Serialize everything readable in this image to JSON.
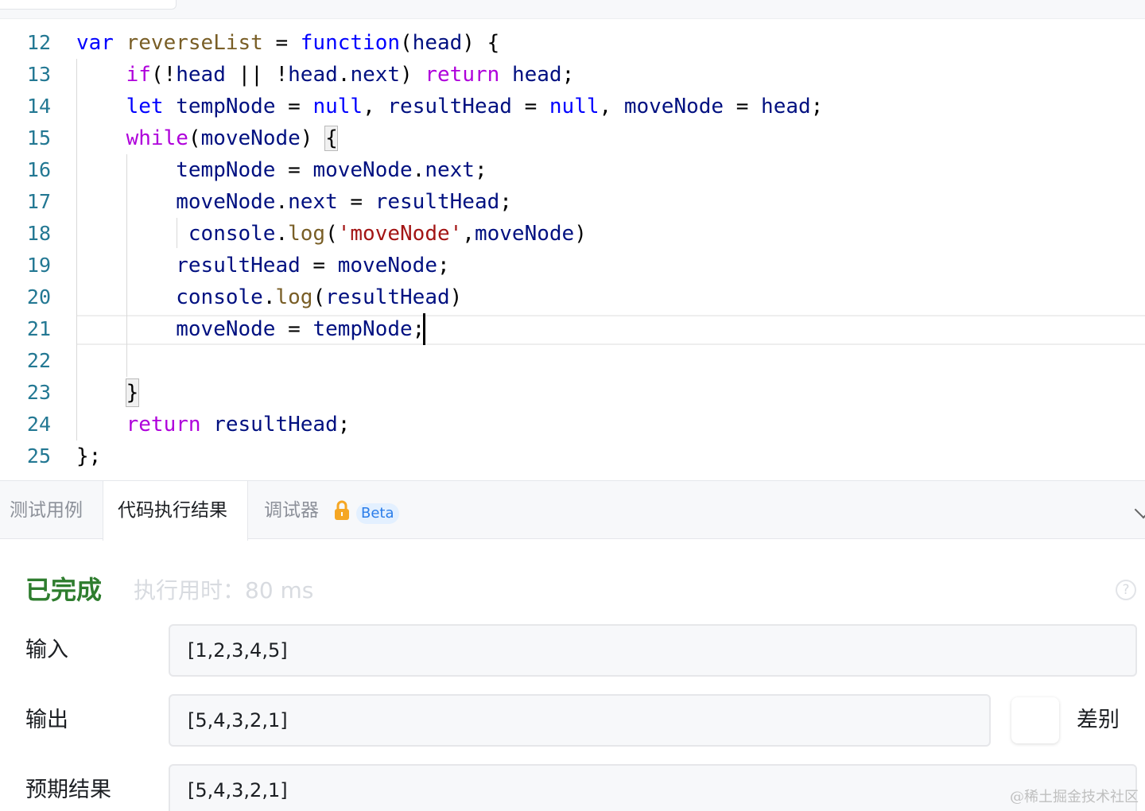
{
  "editor": {
    "lines": [
      {
        "num": "12",
        "tokens": [
          [
            "kw",
            "var"
          ],
          [
            "p",
            " "
          ],
          [
            "fn",
            "reverseList"
          ],
          [
            "p",
            " = "
          ],
          [
            "kw",
            "function"
          ],
          [
            "p",
            "("
          ],
          [
            "var",
            "head"
          ],
          [
            "p",
            ") {"
          ]
        ]
      },
      {
        "num": "13",
        "tokens": [
          [
            "p",
            "    "
          ],
          [
            "ctl",
            "if"
          ],
          [
            "p",
            "(!"
          ],
          [
            "var",
            "head"
          ],
          [
            "p",
            " || !"
          ],
          [
            "var",
            "head"
          ],
          [
            "p",
            "."
          ],
          [
            "var",
            "next"
          ],
          [
            "p",
            ") "
          ],
          [
            "ctl",
            "return"
          ],
          [
            "p",
            " "
          ],
          [
            "var",
            "head"
          ],
          [
            "p",
            ";"
          ]
        ]
      },
      {
        "num": "14",
        "tokens": [
          [
            "p",
            "    "
          ],
          [
            "kw",
            "let"
          ],
          [
            "p",
            " "
          ],
          [
            "var",
            "tempNode"
          ],
          [
            "p",
            " = "
          ],
          [
            "kw",
            "null"
          ],
          [
            "p",
            ", "
          ],
          [
            "var",
            "resultHead"
          ],
          [
            "p",
            " = "
          ],
          [
            "kw",
            "null"
          ],
          [
            "p",
            ", "
          ],
          [
            "var",
            "moveNode"
          ],
          [
            "p",
            " = "
          ],
          [
            "var",
            "head"
          ],
          [
            "p",
            ";"
          ]
        ]
      },
      {
        "num": "15",
        "tokens": [
          [
            "p",
            "    "
          ],
          [
            "ctl",
            "while"
          ],
          [
            "p",
            "("
          ],
          [
            "var",
            "moveNode"
          ],
          [
            "p",
            ") {"
          ]
        ]
      },
      {
        "num": "16",
        "tokens": [
          [
            "p",
            "        "
          ],
          [
            "var",
            "tempNode"
          ],
          [
            "p",
            " = "
          ],
          [
            "var",
            "moveNode"
          ],
          [
            "p",
            "."
          ],
          [
            "var",
            "next"
          ],
          [
            "p",
            ";"
          ]
        ]
      },
      {
        "num": "17",
        "tokens": [
          [
            "p",
            "        "
          ],
          [
            "var",
            "moveNode"
          ],
          [
            "p",
            "."
          ],
          [
            "var",
            "next"
          ],
          [
            "p",
            " = "
          ],
          [
            "var",
            "resultHead"
          ],
          [
            "p",
            ";"
          ]
        ]
      },
      {
        "num": "18",
        "tokens": [
          [
            "p",
            "         "
          ],
          [
            "var",
            "console"
          ],
          [
            "p",
            "."
          ],
          [
            "fn",
            "log"
          ],
          [
            "p",
            "("
          ],
          [
            "str",
            "'moveNode'"
          ],
          [
            "p",
            ","
          ],
          [
            "var",
            "moveNode"
          ],
          [
            "p",
            ")"
          ]
        ]
      },
      {
        "num": "19",
        "tokens": [
          [
            "p",
            "        "
          ],
          [
            "var",
            "resultHead"
          ],
          [
            "p",
            " = "
          ],
          [
            "var",
            "moveNode"
          ],
          [
            "p",
            ";"
          ]
        ]
      },
      {
        "num": "20",
        "tokens": [
          [
            "p",
            "        "
          ],
          [
            "var",
            "console"
          ],
          [
            "p",
            "."
          ],
          [
            "fn",
            "log"
          ],
          [
            "p",
            "("
          ],
          [
            "var",
            "resultHead"
          ],
          [
            "p",
            ")"
          ]
        ]
      },
      {
        "num": "21",
        "tokens": [
          [
            "p",
            "        "
          ],
          [
            "var",
            "moveNode"
          ],
          [
            "p",
            " = "
          ],
          [
            "var",
            "tempNode"
          ],
          [
            "p",
            ";"
          ]
        ]
      },
      {
        "num": "22",
        "tokens": []
      },
      {
        "num": "23",
        "tokens": [
          [
            "p",
            "    }"
          ]
        ]
      },
      {
        "num": "24",
        "tokens": [
          [
            "p",
            "    "
          ],
          [
            "ctl",
            "return"
          ],
          [
            "p",
            " "
          ],
          [
            "var",
            "resultHead"
          ],
          [
            "p",
            ";"
          ]
        ]
      },
      {
        "num": "25",
        "tokens": [
          [
            "p",
            "};"
          ]
        ]
      }
    ],
    "colors": {
      "keyword": "#0000ff",
      "control": "#af00db",
      "variable": "#001080",
      "function": "#795e26",
      "string": "#a31515",
      "line_number": "#237893"
    }
  },
  "tabs": {
    "test_cases": "测试用例",
    "result": "代码执行结果",
    "debugger": "调试器",
    "beta": "Beta",
    "lock_icon": "lock-icon",
    "collapse_icon": "chevron-down-icon"
  },
  "result": {
    "status": "已完成",
    "exec_time": "执行用时：80 ms",
    "status_color": "#2e7d2e",
    "input_label": "输入",
    "input_value": "[1,2,3,4,5]",
    "output_label": "输出",
    "output_value": "[5,4,3,2,1]",
    "expected_label": "预期结果",
    "expected_value": "[5,4,3,2,1]",
    "diff_label": "差别",
    "help_icon": "help-icon"
  },
  "watermark": "@稀土掘金技术社区"
}
